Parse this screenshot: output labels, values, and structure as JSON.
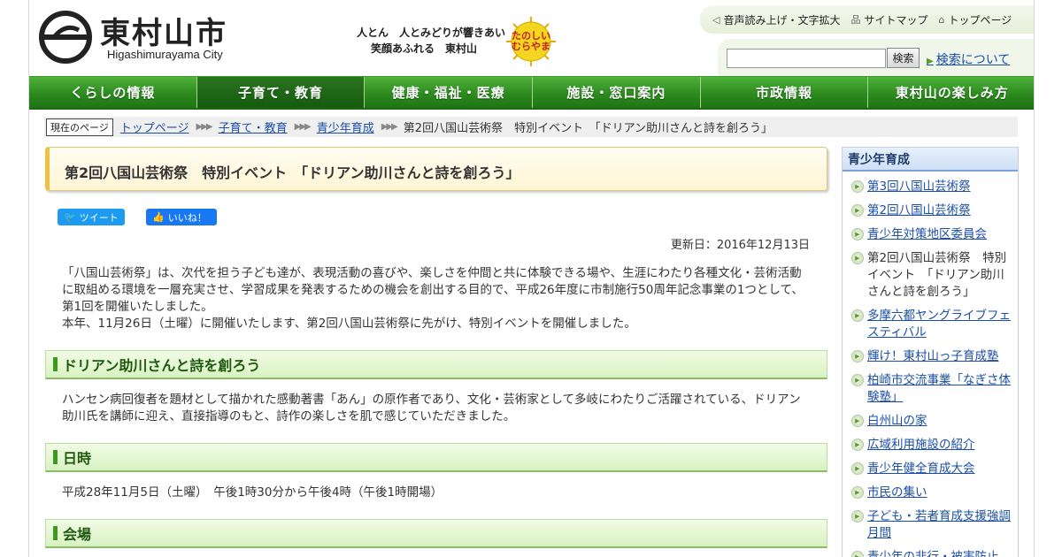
{
  "header": {
    "city_name": "東村山市",
    "city_name_roman": "Higashimurayama City",
    "slogan_line1": "人とん　人とみどりが響きあい",
    "slogan_line2": "笑顔あふれる　東村山",
    "emblem_text": "たのしい むらやま",
    "tools": {
      "voice": "音声読み上げ・文字拡大",
      "sitemap": "サイトマップ",
      "top": "トップページ"
    },
    "search": {
      "value": "",
      "button": "検索",
      "about": "検索について"
    }
  },
  "nav": [
    {
      "label": "くらしの情報",
      "active": false
    },
    {
      "label": "子育て・教育",
      "active": true
    },
    {
      "label": "健康・福祉・医療",
      "active": false
    },
    {
      "label": "施設・窓口案内",
      "active": false
    },
    {
      "label": "市政情報",
      "active": false
    },
    {
      "label": "東村山の楽しみ方",
      "active": false
    }
  ],
  "breadcrumb": {
    "here": "現在のページ",
    "items": [
      "トップページ",
      "子育て・教育",
      "青少年育成"
    ],
    "current": "第2回八国山芸術祭　特別イベント　「ドリアン助川さんと詩を創ろう」"
  },
  "main": {
    "title": "第2回八国山芸術祭　特別イベント　「ドリアン助川さんと詩を創ろう」",
    "share": {
      "tweet": "ツイート",
      "like": "いいね！"
    },
    "updated": "更新日：2016年12月13日",
    "intro_p1": "「八国山芸術祭」は、次代を担う子ども達が、表現活動の喜びや、楽しさを仲間と共に体験できる場や、生涯にわたり各種文化・芸術活動に取組める環境を一層充実させ、学習成果を発表するための機会を創出する目的で、平成26年度に市制施行50周年記念事業の1つとして、第1回を開催いたしました。",
    "intro_p2": "本年、11月26日（土曜）に開催いたします、第2回八国山芸術祭に先がけ、特別イベントを開催しました。",
    "sections": [
      {
        "heading": "ドリアン助川さんと詩を創ろう",
        "text": "ハンセン病回復者を題材として描かれた感動著書「あん」の原作者であり、文化・芸術家として多岐にわたりご活躍されている、ドリアン助川氏を講師に迎え、直接指導のもと、詩作の楽しさを肌で感じていただきました。"
      },
      {
        "heading": "日時",
        "text": "平成28年11月5日（土曜）　午後1時30分から午後4時（午後1時開場）"
      },
      {
        "heading": "会場",
        "text": ""
      }
    ]
  },
  "sidebar": {
    "title": "青少年育成",
    "items": [
      {
        "label": "第3回八国山芸術祭",
        "current": false
      },
      {
        "label": "第2回八国山芸術祭",
        "current": false
      },
      {
        "label": "青少年対策地区委員会",
        "current": false
      },
      {
        "label": "第2回八国山芸術祭　特別イベント　「ドリアン助川さんと詩を創ろう」",
        "current": true
      },
      {
        "label": "多摩六都ヤングライブフェスティバル",
        "current": false
      },
      {
        "label": "輝け！東村山っ子育成塾",
        "current": false
      },
      {
        "label": "柏崎市交流事業「なぎさ体験塾」",
        "current": false
      },
      {
        "label": "白州山の家",
        "current": false
      },
      {
        "label": "広域利用施設の紹介",
        "current": false
      },
      {
        "label": "青少年健全育成大会",
        "current": false
      },
      {
        "label": "市民の集い",
        "current": false
      },
      {
        "label": "子ども・若者育成支援強調月間",
        "current": false
      },
      {
        "label": "青少年の非行・被害防止",
        "current": false
      }
    ]
  },
  "colors": {
    "nav_green": "#2f8a22",
    "nav_active": "#155a0d",
    "link_blue": "#1a4ea8",
    "section_green": "#d8f2c2",
    "title_yellow": "#fff5d4"
  }
}
